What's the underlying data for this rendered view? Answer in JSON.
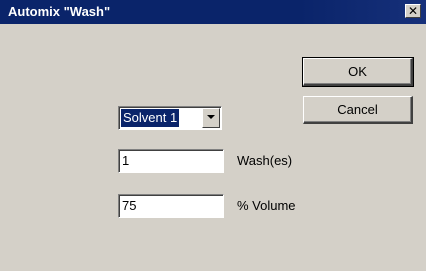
{
  "window": {
    "title": "Automix \"Wash\"",
    "close_icon": "close-icon"
  },
  "buttons": {
    "ok_label": "OK",
    "cancel_label": "Cancel"
  },
  "solvent": {
    "selected": "Solvent 1",
    "arrow_icon": "chevron-down-icon"
  },
  "washes": {
    "value": "1",
    "label": "Wash(es)"
  },
  "volume": {
    "value": "75",
    "label": "% Volume"
  },
  "colors": {
    "titlebar": "#0a246a",
    "face": "#d4d0c8",
    "selection": "#0a246a"
  }
}
